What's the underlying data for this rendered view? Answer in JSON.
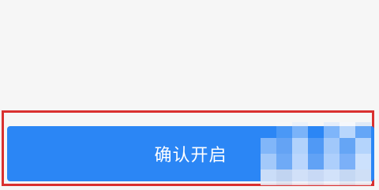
{
  "confirm_button": {
    "label": "确认开启"
  },
  "colors": {
    "page_background": "#f6f6f6",
    "button_background": "#2b86f5",
    "button_text": "#ffffff",
    "highlight_border": "#d9302f"
  }
}
